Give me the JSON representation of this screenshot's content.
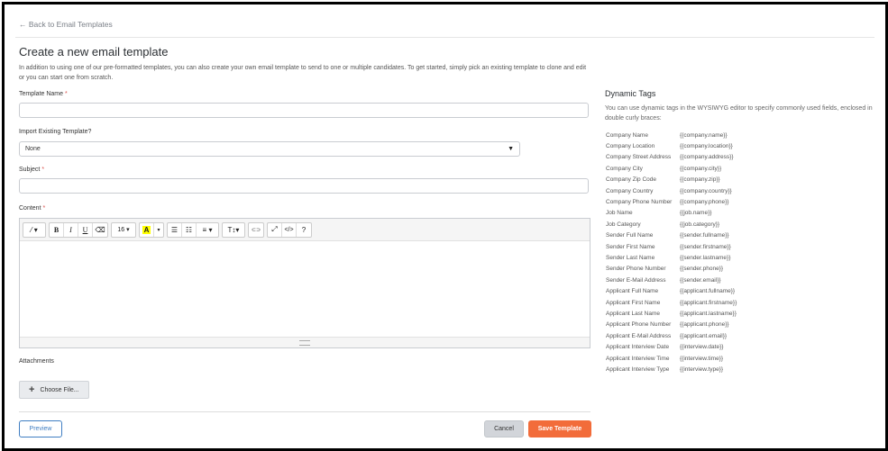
{
  "nav": {
    "back_label": "← Back to Email Templates"
  },
  "page": {
    "title": "Create a new email template",
    "intro": "In addition to using one of our pre-formatted templates, you can also create your own email template to send to one or multiple candidates. To get started, simply pick an existing template to clone and edit or you can start one from scratch."
  },
  "form": {
    "template_name_label": "Template Name",
    "required_mark": "*",
    "template_name_value": "",
    "import_label": "Import Existing Template?",
    "import_selected": "None",
    "subject_label": "Subject",
    "subject_value": "",
    "content_label": "Content",
    "attachments_label": "Attachments",
    "choose_file_label": "Choose File..."
  },
  "toolbar": {
    "magic": "⁄ ▾",
    "bold": "B",
    "italic": "I",
    "underline": "U",
    "eraser": "⌫",
    "font_size": "16 ▾",
    "highlight": "A",
    "highlight_caret": "▾",
    "ul": "☰",
    "ol": "☷",
    "align": "≡ ▾",
    "text_style": "T↕▾",
    "link": "⊂⊃",
    "fullscreen": "⤢",
    "code": "</>",
    "help": "?"
  },
  "buttons": {
    "preview": "Preview",
    "cancel": "Cancel",
    "save": "Save Template"
  },
  "dynamic_tags": {
    "title": "Dynamic Tags",
    "description": "You can use dynamic tags in the WYSIWYG editor to specify commonly used fields, enclosed in double curly braces:",
    "items": [
      {
        "name": "Company Name",
        "code": "{{company.name}}"
      },
      {
        "name": "Company Location",
        "code": "{{company.location}}"
      },
      {
        "name": "Company Street Address",
        "code": "{{company.address}}"
      },
      {
        "name": "Company City",
        "code": "{{company.city}}"
      },
      {
        "name": "Company Zip Code",
        "code": "{{company.zip}}"
      },
      {
        "name": "Company Country",
        "code": "{{company.country}}"
      },
      {
        "name": "Company Phone Number",
        "code": "{{company.phone}}"
      },
      {
        "name": "Job Name",
        "code": "{{job.name}}"
      },
      {
        "name": "Job Category",
        "code": "{{job.category}}"
      },
      {
        "name": "Sender Full Name",
        "code": "{{sender.fullname}}"
      },
      {
        "name": "Sender First Name",
        "code": "{{sender.firstname}}"
      },
      {
        "name": "Sender Last Name",
        "code": "{{sender.lastname}}"
      },
      {
        "name": "Sender Phone Number",
        "code": "{{sender.phone}}"
      },
      {
        "name": "Sender E-Mail Address",
        "code": "{{sender.email}}"
      },
      {
        "name": "Applicant Full Name",
        "code": "{{applicant.fullname}}"
      },
      {
        "name": "Applicant First Name",
        "code": "{{applicant.firstname}}"
      },
      {
        "name": "Applicant Last Name",
        "code": "{{applicant.lastname}}"
      },
      {
        "name": "Applicant Phone Number",
        "code": "{{applicant.phone}}"
      },
      {
        "name": "Applicant E-Mail Address",
        "code": "{{applicant.email}}"
      },
      {
        "name": "Applicant Interview Date",
        "code": "{{interview.date}}"
      },
      {
        "name": "Applicant Interview Time",
        "code": "{{interview.time}}"
      },
      {
        "name": "Applicant Interview Type",
        "code": "{{interview.type}}"
      }
    ]
  },
  "colors": {
    "accent": "#3f7ec2",
    "save": "#f26c3a",
    "required": "#d9534f"
  }
}
